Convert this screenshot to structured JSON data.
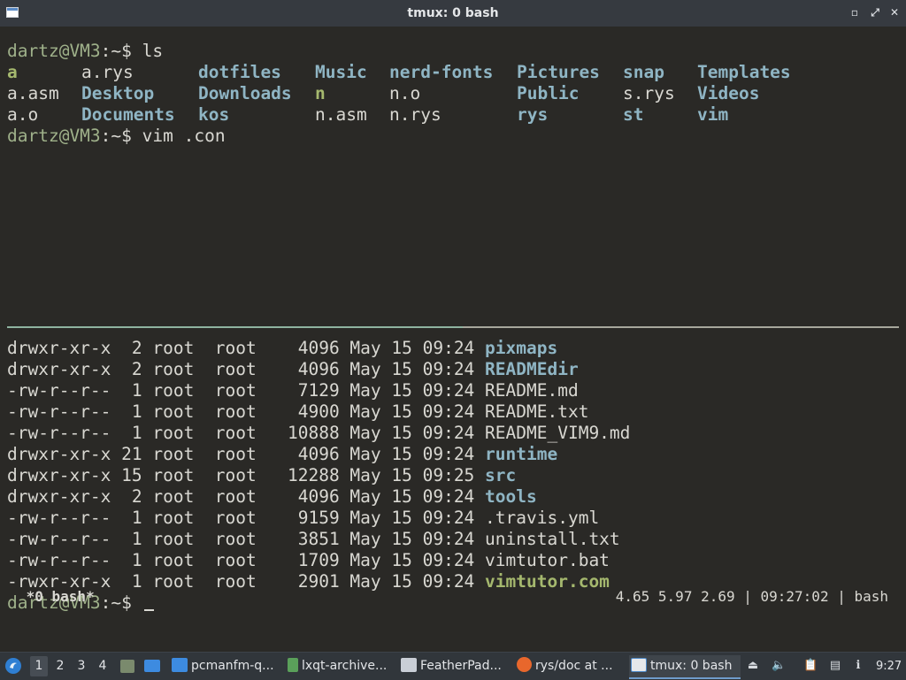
{
  "window": {
    "title": "tmux: 0 bash"
  },
  "terminal": {
    "prompt_user": "dartz@VM3",
    "prompt_path": ":~$ ",
    "cmd1": "ls",
    "ls_rows": [
      [
        {
          "t": "a",
          "k": "exe"
        },
        {
          "t": "a.rys",
          "k": "plain"
        },
        {
          "t": "dotfiles",
          "k": "dir"
        },
        {
          "t": "Music",
          "k": "dir"
        },
        {
          "t": "nerd-fonts",
          "k": "dir"
        },
        {
          "t": "Pictures",
          "k": "dir"
        },
        {
          "t": "snap",
          "k": "dir"
        },
        {
          "t": "Templates",
          "k": "dir"
        }
      ],
      [
        {
          "t": "a.asm",
          "k": "plain"
        },
        {
          "t": "Desktop",
          "k": "dir"
        },
        {
          "t": "Downloads",
          "k": "dir"
        },
        {
          "t": "n",
          "k": "exe"
        },
        {
          "t": "n.o",
          "k": "plain"
        },
        {
          "t": "Public",
          "k": "dir"
        },
        {
          "t": "s.rys",
          "k": "plain"
        },
        {
          "t": "Videos",
          "k": "dir"
        }
      ],
      [
        {
          "t": "a.o",
          "k": "plain"
        },
        {
          "t": "Documents",
          "k": "dir"
        },
        {
          "t": "kos",
          "k": "dir"
        },
        {
          "t": "n.asm",
          "k": "plain"
        },
        {
          "t": "n.rys",
          "k": "plain"
        },
        {
          "t": "rys",
          "k": "dir"
        },
        {
          "t": "st",
          "k": "dir"
        },
        {
          "t": "vim",
          "k": "dir"
        }
      ]
    ],
    "cmd2": "vim .con",
    "listing": [
      {
        "perm": "drwxr-xr-x",
        "links": "2",
        "owner": "root",
        "group": "root",
        "size": "4096",
        "month": "May",
        "day": "15",
        "time": "09:24",
        "name": "pixmaps",
        "kind": "dir"
      },
      {
        "perm": "drwxr-xr-x",
        "links": "2",
        "owner": "root",
        "group": "root",
        "size": "4096",
        "month": "May",
        "day": "15",
        "time": "09:24",
        "name": "READMEdir",
        "kind": "dir"
      },
      {
        "perm": "-rw-r--r--",
        "links": "1",
        "owner": "root",
        "group": "root",
        "size": "7129",
        "month": "May",
        "day": "15",
        "time": "09:24",
        "name": "README.md",
        "kind": "plain"
      },
      {
        "perm": "-rw-r--r--",
        "links": "1",
        "owner": "root",
        "group": "root",
        "size": "4900",
        "month": "May",
        "day": "15",
        "time": "09:24",
        "name": "README.txt",
        "kind": "plain"
      },
      {
        "perm": "-rw-r--r--",
        "links": "1",
        "owner": "root",
        "group": "root",
        "size": "10888",
        "month": "May",
        "day": "15",
        "time": "09:24",
        "name": "README_VIM9.md",
        "kind": "plain"
      },
      {
        "perm": "drwxr-xr-x",
        "links": "21",
        "owner": "root",
        "group": "root",
        "size": "4096",
        "month": "May",
        "day": "15",
        "time": "09:24",
        "name": "runtime",
        "kind": "dir"
      },
      {
        "perm": "drwxr-xr-x",
        "links": "15",
        "owner": "root",
        "group": "root",
        "size": "12288",
        "month": "May",
        "day": "15",
        "time": "09:25",
        "name": "src",
        "kind": "dir"
      },
      {
        "perm": "drwxr-xr-x",
        "links": "2",
        "owner": "root",
        "group": "root",
        "size": "4096",
        "month": "May",
        "day": "15",
        "time": "09:24",
        "name": "tools",
        "kind": "dir"
      },
      {
        "perm": "-rw-r--r--",
        "links": "1",
        "owner": "root",
        "group": "root",
        "size": "9159",
        "month": "May",
        "day": "15",
        "time": "09:24",
        "name": ".travis.yml",
        "kind": "plain"
      },
      {
        "perm": "-rw-r--r--",
        "links": "1",
        "owner": "root",
        "group": "root",
        "size": "3851",
        "month": "May",
        "day": "15",
        "time": "09:24",
        "name": "uninstall.txt",
        "kind": "plain"
      },
      {
        "perm": "-rw-r--r--",
        "links": "1",
        "owner": "root",
        "group": "root",
        "size": "1709",
        "month": "May",
        "day": "15",
        "time": "09:24",
        "name": "vimtutor.bat",
        "kind": "plain"
      },
      {
        "perm": "-rwxr-xr-x",
        "links": "1",
        "owner": "root",
        "group": "root",
        "size": "2901",
        "month": "May",
        "day": "15",
        "time": "09:24",
        "name": "vimtutor.com",
        "kind": "exe"
      }
    ]
  },
  "tmux": {
    "window_label": " *0 bash*",
    "status_right": "4.65 5.97 2.69 | 09:27:02 | bash"
  },
  "taskbar": {
    "desktops": [
      "1",
      "2",
      "3",
      "4"
    ],
    "tasks": [
      {
        "label": "pcmanfm-q...",
        "icon": "folder-icon"
      },
      {
        "label": "lxqt-archive...",
        "icon": "archive-icon"
      },
      {
        "label": "FeatherPad...",
        "icon": "featherpad-icon"
      },
      {
        "label": "rys/doc at ...",
        "icon": "firefox-icon"
      },
      {
        "label": "tmux: 0 bash",
        "icon": "terminal-icon"
      }
    ],
    "clock": "9:27"
  },
  "colors": {
    "dir": "#8fb5c4",
    "exe": "#a5b86e",
    "prompt": "#9fb18a",
    "background": "#2a2926",
    "taskbar": "#31363b"
  }
}
